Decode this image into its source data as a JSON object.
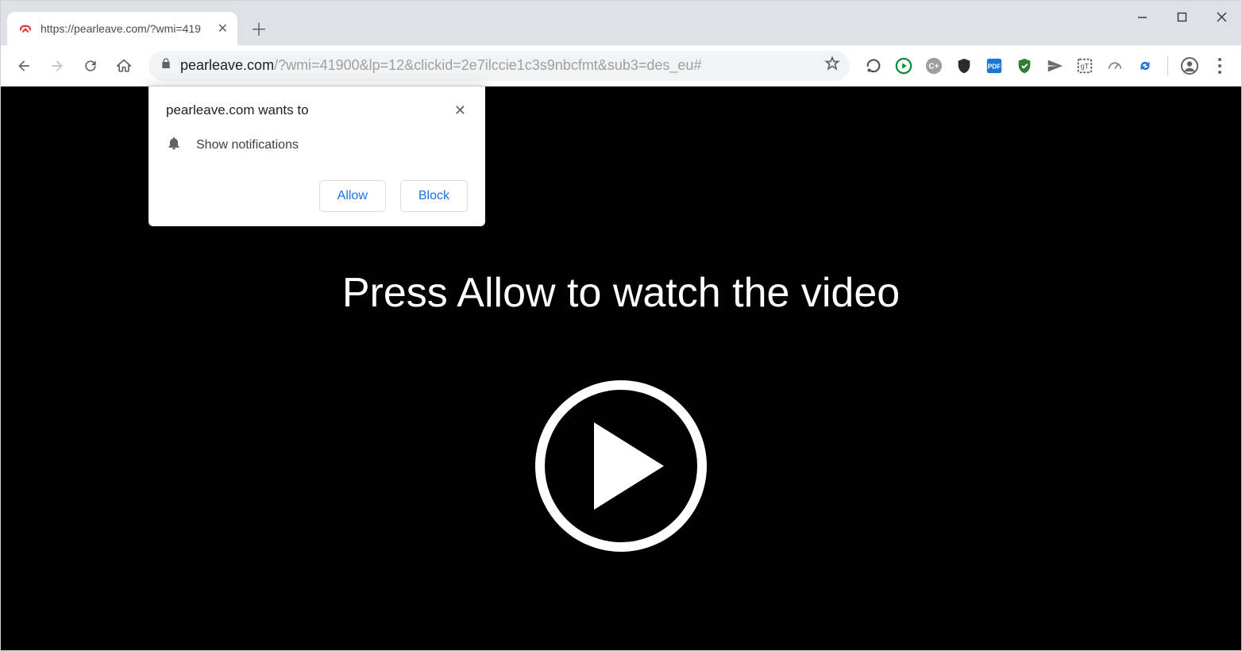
{
  "tab": {
    "title": "https://pearleave.com/?wmi=419"
  },
  "url": {
    "host": "pearleave.com",
    "rest": "/?wmi=41900&lp=12&clickid=2e7ilccie1c3s9nbcfmt&sub3=des_eu#"
  },
  "extensions": [
    "extension-1",
    "extension-play",
    "extension-cplus",
    "extension-shield-dark",
    "extension-pdf",
    "extension-shield-green",
    "extension-telegram",
    "extension-translate",
    "extension-speed",
    "extension-sync"
  ],
  "permission": {
    "title": "pearleave.com wants to",
    "message": "Show notifications",
    "allow": "Allow",
    "block": "Block"
  },
  "page": {
    "headline": "Press Allow to watch the video"
  }
}
